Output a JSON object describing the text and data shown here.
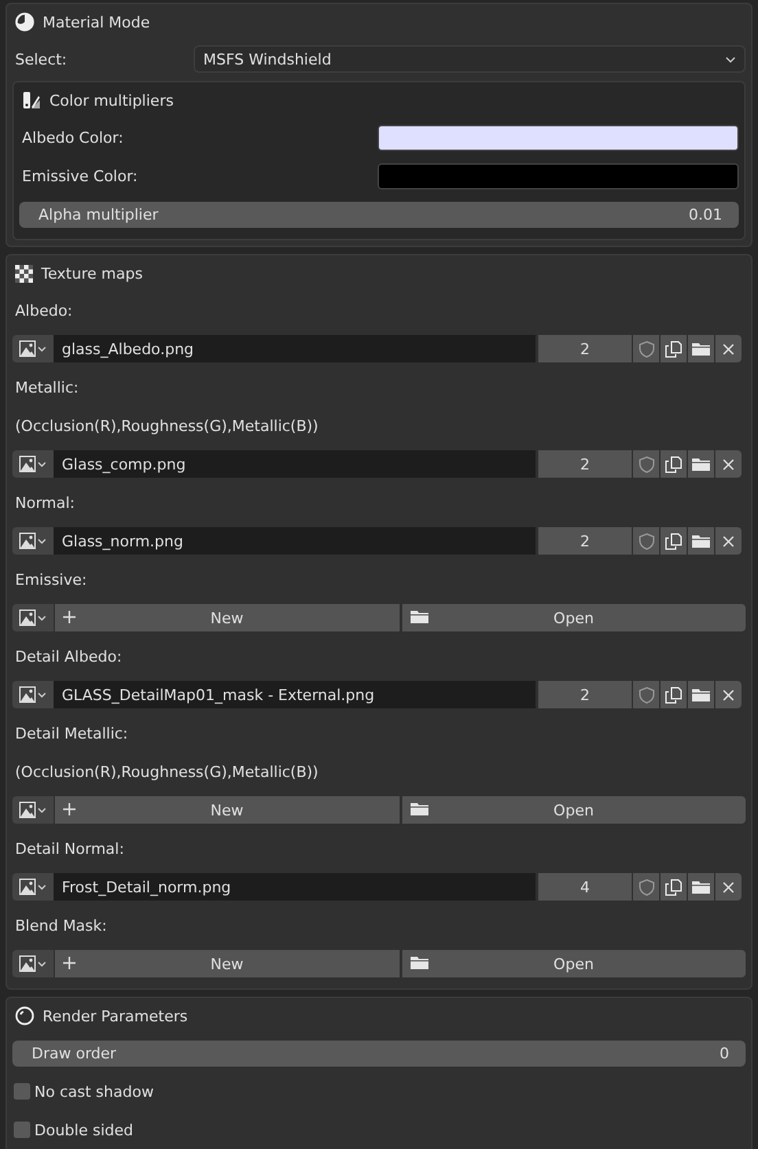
{
  "material_mode": {
    "title": "Material Mode",
    "select_label": "Select:",
    "select_value": "MSFS Windshield",
    "color_multipliers": {
      "title": "Color multipliers",
      "colors": [
        {
          "label": "Albedo Color:",
          "color": "#dfe0ff"
        },
        {
          "label": "Emissive Color:",
          "color": "#000000"
        }
      ],
      "slider": {
        "label": "Alpha multiplier",
        "value": "0.01"
      }
    }
  },
  "texture_maps": {
    "title": "Texture maps",
    "items": [
      {
        "kind": "label",
        "text": "Albedo:"
      },
      {
        "kind": "image",
        "file": "glass_Albedo.png",
        "users": "2"
      },
      {
        "kind": "label",
        "text": "Metallic:"
      },
      {
        "kind": "label",
        "text": "(Occlusion(R),Roughness(G),Metallic(B))"
      },
      {
        "kind": "image",
        "file": "Glass_comp.png",
        "users": "2"
      },
      {
        "kind": "label",
        "text": "Normal:"
      },
      {
        "kind": "image",
        "file": "Glass_norm.png",
        "users": "2"
      },
      {
        "kind": "label",
        "text": "Emissive:"
      },
      {
        "kind": "empty",
        "new_label": "New",
        "open_label": "Open"
      },
      {
        "kind": "label",
        "text": "Detail Albedo:"
      },
      {
        "kind": "image",
        "file": "GLASS_DetailMap01_mask - External.png",
        "users": "2"
      },
      {
        "kind": "label",
        "text": "Detail Metallic:"
      },
      {
        "kind": "label",
        "text": "(Occlusion(R),Roughness(G),Metallic(B))"
      },
      {
        "kind": "empty",
        "new_label": "New",
        "open_label": "Open"
      },
      {
        "kind": "label",
        "text": "Detail Normal:"
      },
      {
        "kind": "image",
        "file": "Frost_Detail_norm.png",
        "users": "4"
      },
      {
        "kind": "label",
        "text": "Blend Mask:"
      },
      {
        "kind": "empty",
        "new_label": "New",
        "open_label": "Open"
      }
    ]
  },
  "render_parameters": {
    "title": "Render Parameters",
    "slider": {
      "label": "Draw order",
      "value": "0"
    },
    "checkboxes": [
      {
        "label": "No cast shadow",
        "checked": false
      },
      {
        "label": "Double sided",
        "checked": false
      }
    ]
  }
}
